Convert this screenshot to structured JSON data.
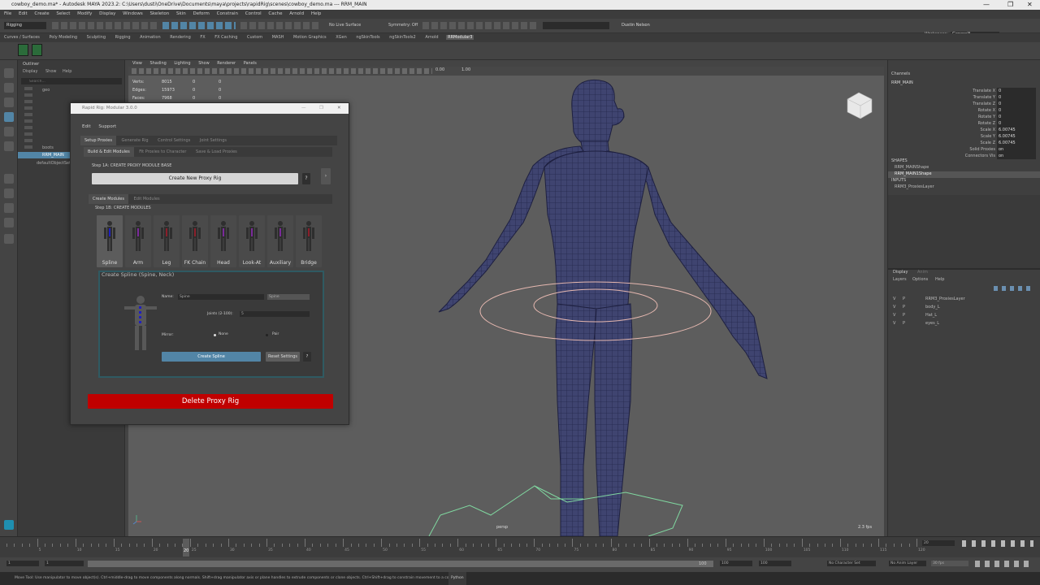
{
  "window": {
    "title": "cowboy_demo.ma* - Autodesk MAYA 2023.2: C:\\Users\\dusti\\OneDrive\\Documents\\maya\\projects\\rapidRig\\scenes\\cowboy_demo.ma  ---  RRM_MAIN",
    "controls": [
      "—",
      "❐",
      "✕"
    ]
  },
  "menubar": {
    "items": [
      "File",
      "Edit",
      "Create",
      "Select",
      "Modify",
      "Display",
      "Windows",
      "Skeleton",
      "Skin",
      "Deform",
      "Constrain",
      "Control",
      "Cache",
      "Arnold",
      "Help"
    ]
  },
  "statusline": {
    "menuset": "Rigging",
    "live_surface": "No Live Surface",
    "symmetry": "Symmetry: Off",
    "user": "Dustin Nelson",
    "workspace_label": "Workspace:",
    "workspace_value": "General*"
  },
  "shelf": {
    "tabs": [
      "Curves / Surfaces",
      "Poly Modeling",
      "Sculpting",
      "Rigging",
      "Animation",
      "Rendering",
      "FX",
      "FX Caching",
      "Custom",
      "MASH",
      "Motion Graphics",
      "XGen",
      "ngSkinTools",
      "ngSkinTools2",
      "Arnold",
      "RRModular3"
    ],
    "active_tab": "RRModular3"
  },
  "outliner": {
    "title": "Outliner",
    "menus": [
      "Display",
      "Show",
      "Help"
    ],
    "search_placeholder": "Search...",
    "items": [
      "geo",
      "boots",
      "RRM_MAIN",
      "defaultObjectSet"
    ],
    "selected": "RRM_MAIN"
  },
  "viewport": {
    "menus": [
      "View",
      "Shading",
      "Lighting",
      "Show",
      "Renderer",
      "Panels"
    ],
    "near_value": "0.00",
    "far_value": "1.00",
    "hud": [
      {
        "label": "Verts:",
        "v1": "8015",
        "v2": "0",
        "v3": "0"
      },
      {
        "label": "Edges:",
        "v1": "15973",
        "v2": "0",
        "v3": "0"
      },
      {
        "label": "Faces:",
        "v1": "7968",
        "v2": "0",
        "v3": "0"
      }
    ],
    "camera": "persp",
    "fps": "2.3 fps"
  },
  "channels": {
    "tabs": [
      "Channels"
    ],
    "object": "RRM_MAIN",
    "attrs": [
      {
        "name": "Translate X",
        "value": "0"
      },
      {
        "name": "Translate Y",
        "value": "0"
      },
      {
        "name": "Translate Z",
        "value": "0"
      },
      {
        "name": "Rotate X",
        "value": "0"
      },
      {
        "name": "Rotate Y",
        "value": "0"
      },
      {
        "name": "Rotate Z",
        "value": "0"
      },
      {
        "name": "Scale X",
        "value": "6.00745"
      },
      {
        "name": "Scale Y",
        "value": "6.00745"
      },
      {
        "name": "Scale Z",
        "value": "6.00745"
      },
      {
        "name": "Solid Proxies",
        "value": "on"
      },
      {
        "name": "Connectors Vis",
        "value": "on"
      }
    ],
    "shapes_label": "SHAPES",
    "shapes": [
      "RRM_MAINShape",
      "RRM_MAIN1Shape"
    ],
    "inputs_label": "INPUTS",
    "inputs": [
      "RRM3_ProxiesLayer"
    ]
  },
  "layers": {
    "tabs": [
      "Display",
      "Anim"
    ],
    "menus": [
      "Layers",
      "Options",
      "Help"
    ],
    "rows": [
      {
        "v": "V",
        "p": "P",
        "name": "RRM3_ProxiesLayer"
      },
      {
        "v": "V",
        "p": "P",
        "name": "body_L"
      },
      {
        "v": "V",
        "p": "P",
        "name": "Hat_L"
      },
      {
        "v": "V",
        "p": "P",
        "name": "eyes_L"
      }
    ]
  },
  "rrm": {
    "title": "Rapid Rig: Modular 3.0.0",
    "menus": [
      "Edit",
      "Support"
    ],
    "main_tabs": [
      "Setup Proxies",
      "Generate Rig",
      "Control Settings",
      "Joint Settings"
    ],
    "sub_tabs": [
      "Build & Edit Modules",
      "Fit Proxies to Character",
      "Save & Load Proxies"
    ],
    "step1a": "Step 1A: CREATE PROXY MODULE BASE",
    "create_base_button": "Create New Proxy Rig",
    "help_glyph": "?",
    "arrow_glyph": "›",
    "module_tabs": [
      "Create Modules",
      "Edit Modules"
    ],
    "step1b": "Step 1B: CREATE MODULES",
    "modules": [
      "Spline",
      "Arm",
      "Leg",
      "FK Chain",
      "Head",
      "Look-At",
      "Auxiliary",
      "Bridge"
    ],
    "create_title": "Create Spline (Spine, Neck)",
    "name_label": "Name:",
    "name_value": "Spine",
    "type_value": "Spine",
    "joints_label": "Joints (2-100):",
    "joints_value": "5",
    "mirror_label": "Mirror:",
    "mirror_none": "None",
    "mirror_pair": "Pair",
    "create_button": "Create Spline",
    "reset_button": "Reset Settings",
    "delete_button": "Delete Proxy Rig"
  },
  "timeline": {
    "ticks": [
      "5",
      "10",
      "15",
      "20",
      "25",
      "30",
      "35",
      "40",
      "45",
      "50",
      "55",
      "60",
      "65",
      "70",
      "75",
      "80",
      "85",
      "90",
      "95",
      "100",
      "105",
      "110",
      "115",
      "120"
    ],
    "current_frame": "20",
    "current_frame_field": "20"
  },
  "range": {
    "start": "1",
    "start_inner": "1",
    "end_inner": "100",
    "end_field": "100",
    "end_total": "100",
    "char_set": "No Character Set",
    "anim_layer": "No Anim Layer",
    "fps": "30 fps"
  },
  "helpline": {
    "text": "Move Tool: Use manipulator to move object(s). Ctrl+middle-drag to move components along normals. Shift+drag manipulator axis or plane handles to extrude components or clone objects. Ctrl+Shift+drag to constrain movement to a con",
    "lang": "Python"
  },
  "colors": {
    "accent": "#5285a6",
    "delete_red": "#c00000",
    "selected_blue": "#5285a6",
    "mesh_blue": "#3b3f6a"
  }
}
